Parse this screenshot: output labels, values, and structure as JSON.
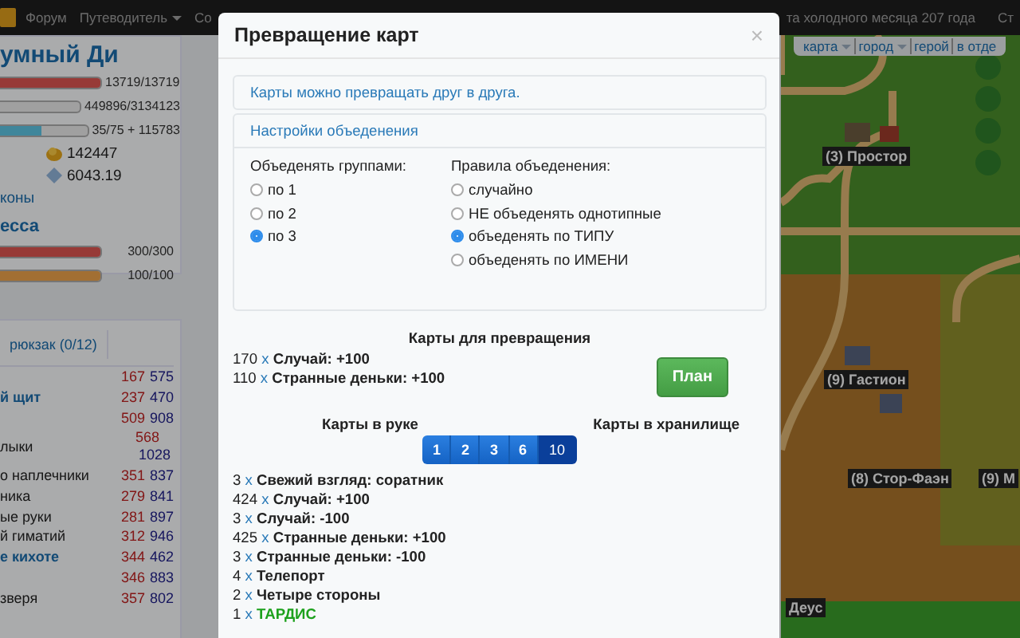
{
  "navbar": {
    "items": [
      {
        "label": "Форум",
        "dropdown": false
      },
      {
        "label": "Путеводитель",
        "dropdown": true
      },
      {
        "label": "Со",
        "dropdown": false
      }
    ],
    "date": "та холодного месяца 207 года",
    "right_link": "Ст"
  },
  "hero": {
    "name": "умный Ди",
    "bars": [
      {
        "kind": "health",
        "level": 1,
        "reading": "13719/13719"
      },
      {
        "kind": "experience",
        "level": 0.14,
        "reading": "449896/3134123"
      },
      {
        "kind": "mana",
        "level": 0.47,
        "reading": "35/75 + 115783"
      }
    ],
    "gold": "142447",
    "gems": "6043.19",
    "link": "коны",
    "section": "есса",
    "bars2": [
      {
        "kind": "health",
        "level": 1,
        "reading": "300/300"
      },
      {
        "kind": "stamina",
        "level": 1,
        "reading": "100/100"
      }
    ]
  },
  "inventory": {
    "tab": "рюкзак (0/12)",
    "items": [
      {
        "stacked": false,
        "price_a": "167",
        "price_b": "575"
      },
      {
        "kind": "link",
        "stacked": false,
        "name": "й щит",
        "price_a": "237",
        "price_b": "470"
      },
      {
        "stacked": false,
        "price_a": "509",
        "price_b": "908"
      },
      {
        "kind": "plain",
        "stacked": true,
        "name": "лыки",
        "price_a": "568",
        "price_b": "1028"
      },
      {
        "kind": "plain",
        "stacked": false,
        "name": "о наплечники",
        "price_a": "351",
        "price_b": "837"
      },
      {
        "kind": "plain",
        "stacked": false,
        "name": "ника",
        "price_a": "279",
        "price_b": "841"
      },
      {
        "kind": "plain",
        "stacked": false,
        "name": "ые руки",
        "price_a": "281",
        "price_b": "897"
      },
      {
        "kind": "plain",
        "stacked": false,
        "name": "й гиматий",
        "price_a": "312",
        "price_b": "946"
      },
      {
        "kind": "link",
        "stacked": false,
        "name": "е кихоте",
        "price_a": "344",
        "price_b": "462"
      },
      {
        "stacked": false,
        "price_a": "346",
        "price_b": "883"
      },
      {
        "kind": "plain",
        "stacked": false,
        "name": "зверя",
        "price_a": "357",
        "price_b": "802"
      }
    ]
  },
  "map": {
    "links": [
      {
        "label": "карта",
        "dropdown": true
      },
      {
        "label": "город",
        "dropdown": true
      },
      {
        "label": "герой",
        "dropdown": false
      },
      {
        "label": "в отде",
        "dropdown": false
      }
    ],
    "places": [
      {
        "label": "(3) Простор"
      },
      {
        "label": "(9) Гастион"
      },
      {
        "label": "(8) Стор-Фаэн"
      },
      {
        "label": "(9) М"
      },
      {
        "label": "Деус"
      }
    ]
  },
  "modal": {
    "title": "Превращение карт",
    "close": "×",
    "info": "Карты можно превращать друг в друга.",
    "settings": {
      "title": "Настройки объеденения",
      "groups": [
        {
          "label": "Объеденять группами:",
          "options": [
            {
              "label": "по 1",
              "selected": false
            },
            {
              "label": "по 2",
              "selected": false
            },
            {
              "label": "по 3",
              "selected": true
            }
          ]
        },
        {
          "label": "Правила объеденения:",
          "options": [
            {
              "label": "случайно",
              "selected": false
            },
            {
              "label": "НЕ объеденять однотипные",
              "selected": false
            },
            {
              "label": "объеденять по ТИПУ",
              "selected": true
            },
            {
              "label": "объеденять по ИМЕНИ",
              "selected": false
            }
          ]
        }
      ]
    },
    "convert": {
      "title": "Карты для превращения",
      "cards": [
        {
          "count": "170",
          "times": "x",
          "name": "Случай: +100"
        },
        {
          "count": "110",
          "times": "x",
          "name": "Странные деньки: +100"
        }
      ]
    },
    "plan_button": "План",
    "hand_label": "Карты в руке",
    "storage_label": "Карты в хранилище",
    "pages": [
      {
        "label": "1",
        "selected": false
      },
      {
        "label": "2",
        "selected": false
      },
      {
        "label": "3",
        "selected": false
      },
      {
        "label": "6",
        "selected": false
      },
      {
        "label": "10",
        "selected": true
      }
    ],
    "cards": [
      {
        "count": "3",
        "times": "x",
        "name": "Свежий взгляд: соратник",
        "kind": "common"
      },
      {
        "count": "424",
        "times": "x",
        "name": "Случай: +100",
        "kind": "common"
      },
      {
        "count": "3",
        "times": "x",
        "name": "Случай: -100",
        "kind": "common"
      },
      {
        "count": "425",
        "times": "x",
        "name": "Странные деньки: +100",
        "kind": "common"
      },
      {
        "count": "3",
        "times": "x",
        "name": "Странные деньки: -100",
        "kind": "common"
      },
      {
        "count": "4",
        "times": "x",
        "name": "Телепорт",
        "kind": "common"
      },
      {
        "count": "2",
        "times": "x",
        "name": "Четыре стороны",
        "kind": "common"
      },
      {
        "count": "1",
        "times": "x",
        "name": "ТАРДИС",
        "kind": "rare"
      }
    ]
  }
}
